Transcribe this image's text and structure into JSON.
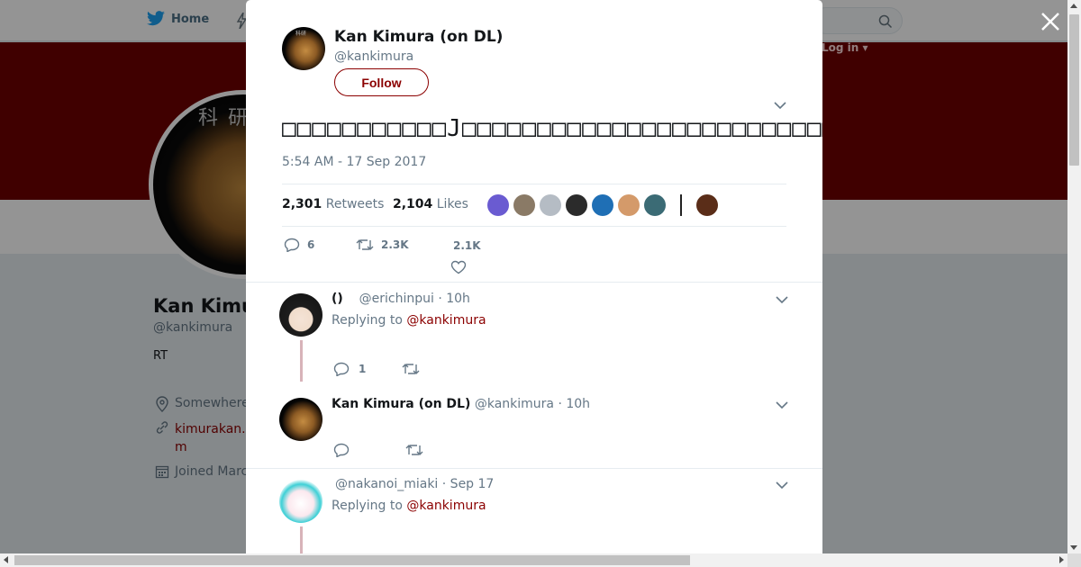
{
  "nav": {
    "home_label": "Home",
    "login_label": "Log in"
  },
  "profile": {
    "name": "Kan Kimura",
    "handle": "@kankimura",
    "bio": "RT",
    "location": "Somewhere",
    "link_text": "kimurakan.w",
    "link_text_2": "m",
    "joined": "Joined Marc",
    "avatar_lettering": "科 研"
  },
  "tweet": {
    "author_name": "Kan Kimura (on DL)",
    "author_handle": "@kankimura",
    "follow_label": "Follow",
    "text": "□□□□□□□□□□□J□□□□□□□□□□□□□□□□□□□□□□□□□□□□□□□□□□□□□□□□□",
    "timestamp": "5:54 AM - 17 Sep 2017",
    "retweet_count": "2,301",
    "retweet_label": "Retweets",
    "like_count": "2,104",
    "like_label": "Likes",
    "reply_action_count": "6",
    "retweet_action_count": "2.3K",
    "like_action_count": "2.1K"
  },
  "likers": [
    {
      "name": "liker-1",
      "color": "#6a5bd1"
    },
    {
      "name": "liker-2",
      "color": "#8a7a66"
    },
    {
      "name": "liker-3",
      "color": "#b5bcc4"
    },
    {
      "name": "liker-4",
      "color": "#2b2b2b"
    },
    {
      "name": "liker-5",
      "color": "#1f6fb5"
    },
    {
      "name": "liker-6",
      "color": "#d49a6a"
    },
    {
      "name": "liker-7",
      "color": "#3b6b75"
    },
    {
      "name": "liker-8",
      "color": "#ffffff"
    },
    {
      "name": "liker-9",
      "color": "#5a2d18"
    }
  ],
  "replies": [
    {
      "name": "()",
      "handle": "@erichinpui",
      "time": "· 10h",
      "replying_prefix": "Replying to",
      "replying_to": "@kankimura",
      "reply_count": "1"
    },
    {
      "name": "Kan Kimura (on DL)",
      "handle": "@kankimura",
      "time": "· 10h"
    },
    {
      "name": "",
      "handle": "@nakanoi_miaki",
      "time": "· Sep 17",
      "replying_prefix": "Replying to",
      "replying_to": "@kankimura"
    }
  ],
  "colors": {
    "accent": "#8b0000",
    "banner": "#6f0000",
    "muted": "#657786"
  }
}
